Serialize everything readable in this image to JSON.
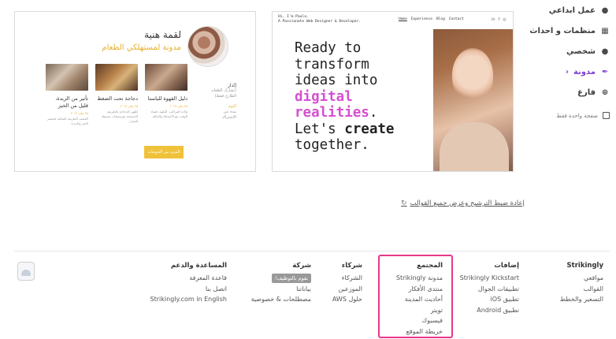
{
  "sidebar": {
    "categories": [
      {
        "label": "عمل ابداعي",
        "icon": "palette-icon"
      },
      {
        "label": "منظمات و احداث",
        "icon": "calendar-icon"
      },
      {
        "label": "شخصي",
        "icon": "person-icon"
      },
      {
        "label": "مدونة",
        "icon": "quill-icon",
        "active": true
      },
      {
        "label": "فارغ",
        "icon": "plus-circle-icon"
      }
    ],
    "one_page_label": "صفحة واحدة فقط"
  },
  "blog_card": {
    "title": "لقمة هنية",
    "subtitle": "مدونة لمستهلكي الطعام",
    "side": {
      "heading": "إنّذار",
      "line1": "(تشارك الطعام",
      "line2": "الطازج فقط)",
      "link": "اليوم",
      "line3": "مدة عن",
      "line4": "الاشتراك"
    },
    "posts": [
      {
        "title": "دليل القهوة للباستا",
        "date": "٢٥ يناير ٢٠١٩",
        "body": "ولادة المراكب. النكهة. قضاء الوقت مع الأصدقاء والعائلة."
      },
      {
        "title": "دجاجة تحت الضغط",
        "date": "٢٥ يناير ٢٠١٩",
        "body": "إطهي الدجاجة بالطريقة الصحيحة مع وصفات بسيطة للمنزل."
      },
      {
        "title": "تأثير من الزبدة، قليل من الخبز",
        "date": "٢٥ يناير ٢٠١٩",
        "body": "اكتشف الطريقة المثالية لتحضير الخبز والزبدة."
      }
    ],
    "button_label": "المزيد من التدوينات"
  },
  "paula_card": {
    "intro_line1": "Hi, I'm Paula.",
    "intro_line2": "A Passionate Web Designer & Developer.",
    "nav": [
      "Home",
      "Experience",
      "Blog",
      "Contact"
    ],
    "social": [
      "in",
      "f",
      "◎"
    ],
    "headline": {
      "l1": "Ready to",
      "l2": "transform",
      "l3": "ideas into",
      "l4": "digital",
      "l5": "realities",
      "l5_suffix": ".",
      "l6_prefix": "Let's ",
      "l6_bold": "create",
      "l7": "together."
    },
    "accent": "#d64fd0"
  },
  "reset_link": "إعادة ضبط الترشيح وعرض جميع القوالب",
  "footer": {
    "strikingly": {
      "heading": "Strikingly",
      "items": [
        "مواقعي",
        "القوالب",
        "التسعير والخطط"
      ]
    },
    "addons": {
      "heading": "إضافات",
      "items": [
        "Strikingly Kickstart",
        "تطبيقات الجوال",
        "تطبيق iOS",
        "تطبيق Android"
      ]
    },
    "community": {
      "heading": "المجتمع",
      "items": [
        "مدونة Strikingly",
        "منتدى الأفكار",
        "أحاديث المدينة",
        "تويتر",
        "فيسبوك",
        "خريطة الموقع"
      ]
    },
    "partners": {
      "heading": "شركاء",
      "items": [
        "الشركاء",
        "الموزعين",
        "حلول AWS"
      ]
    },
    "company": {
      "heading": "شركة",
      "badge": "نقوم بالتوظيف!",
      "items": [
        "بياناتنا",
        "مصطلحات & خصوصية"
      ]
    },
    "help": {
      "heading": "المساعدة والدعم",
      "items": [
        "قاعدة المعرفة",
        "اتصل بنا",
        "Strikingly.com in English"
      ]
    },
    "highlight_color": "#e8388a"
  }
}
